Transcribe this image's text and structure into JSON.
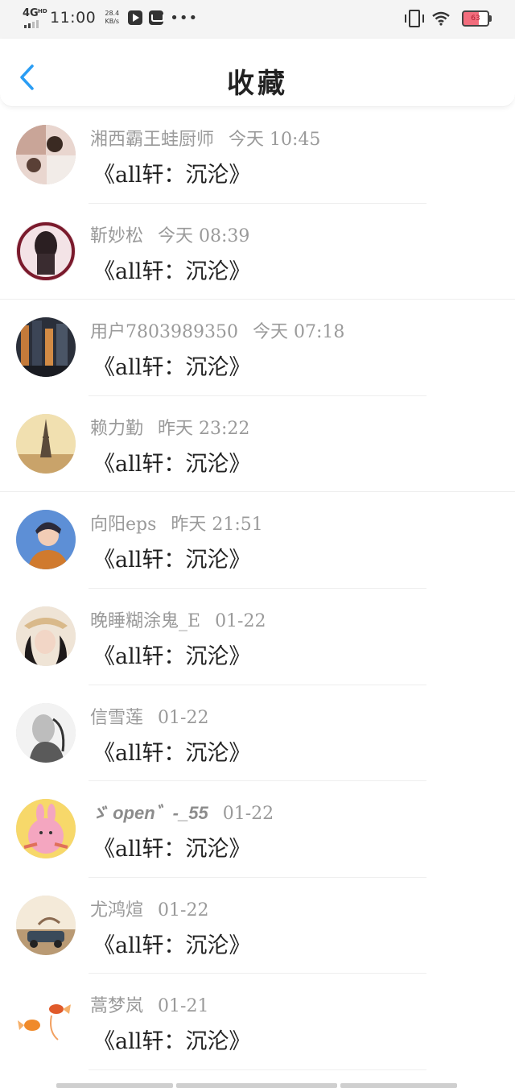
{
  "status_bar": {
    "network": "4G",
    "hd": "HD",
    "time": "11:00",
    "speed_value": "28.4",
    "speed_unit": "KB/s",
    "more": "•••",
    "battery": "63",
    "icons": [
      "signal-icon",
      "play-app-icon",
      "message-app-icon",
      "vibrate-icon",
      "wifi-icon",
      "battery-icon"
    ]
  },
  "header": {
    "title": "收藏",
    "accent_color": "#2a9df4"
  },
  "favorites": [
    {
      "name": "湘西霸王蛙厨师",
      "time": "今天 10:45",
      "title": "《all轩：沉沦》",
      "bold": false
    },
    {
      "name": "靳妙松",
      "time": "今天 08:39",
      "title": "《all轩：沉沦》",
      "bold": false
    },
    {
      "name": "用户7803989350",
      "time": "今天 07:18",
      "title": "《all轩：沉沦》",
      "bold": false
    },
    {
      "name": "赖力勤",
      "time": "昨天 23:22",
      "title": "《all轩：沉沦》",
      "bold": false
    },
    {
      "name": "向阳eps",
      "time": "昨天 21:51",
      "title": "《all轩：沉沦》",
      "bold": false
    },
    {
      "name": "晚睡糊涂鬼_E",
      "time": "01-22",
      "title": "《all轩：沉沦》",
      "bold": false
    },
    {
      "name": "信雪莲",
      "time": "01-22",
      "title": "《all轩：沉沦》",
      "bold": false
    },
    {
      "name": "ゞ open゛-_55",
      "time": "01-22",
      "title": "《all轩：沉沦》",
      "bold": true
    },
    {
      "name": "尤鸿煊",
      "time": "01-22",
      "title": "《all轩：沉沦》",
      "bold": false
    },
    {
      "name": "蒿梦岚",
      "time": "01-21",
      "title": "《all轩：沉沦》",
      "bold": false
    }
  ]
}
